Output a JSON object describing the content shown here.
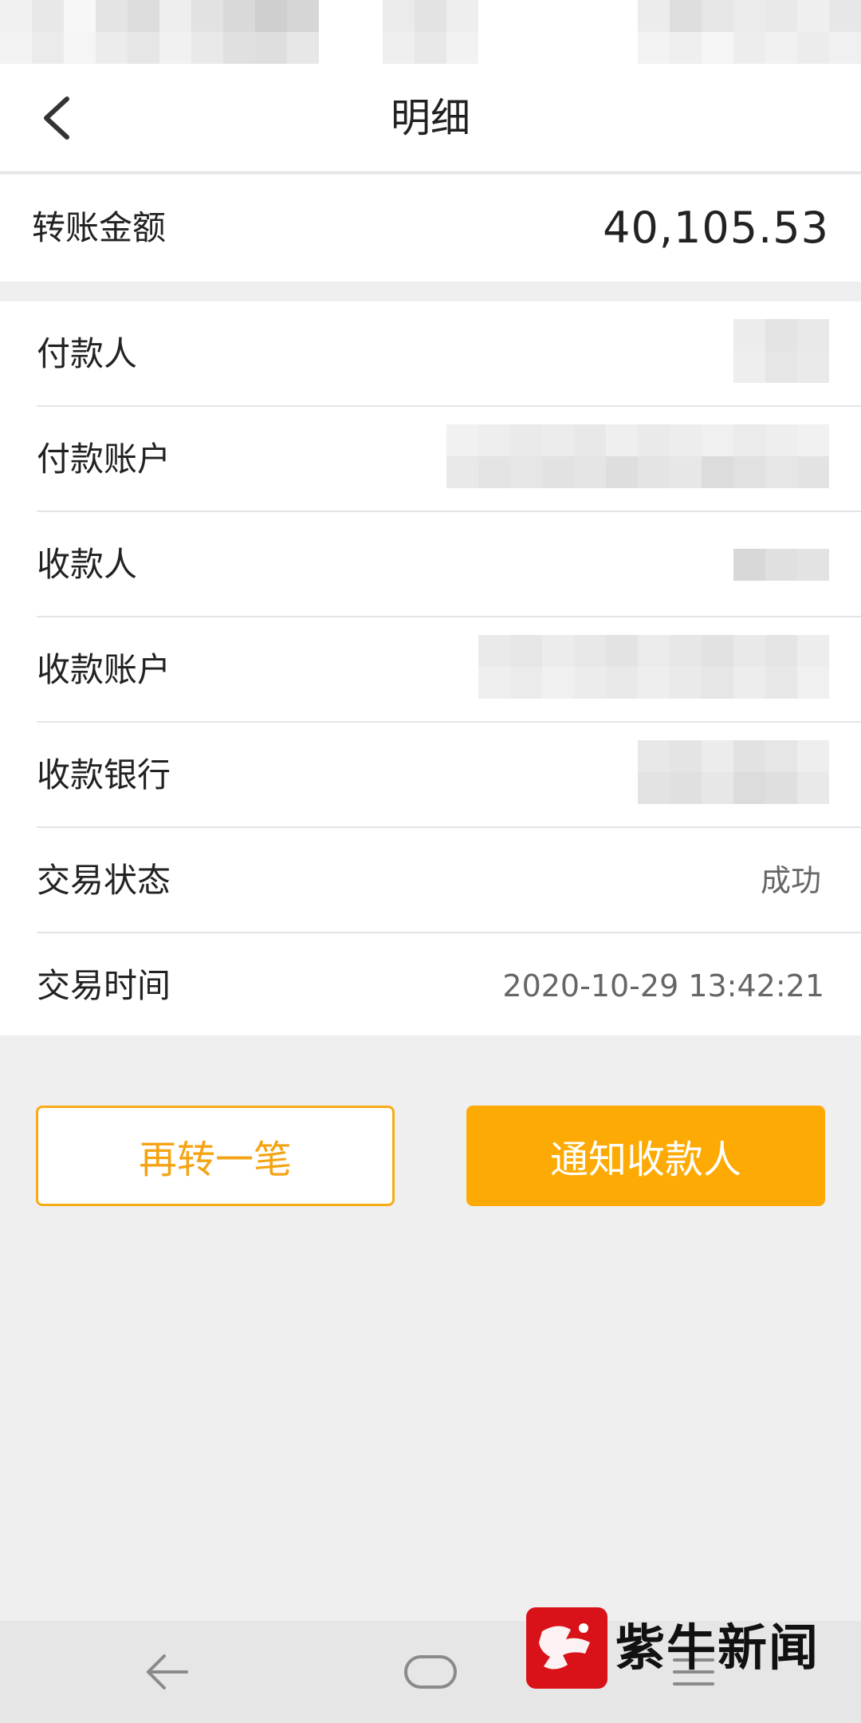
{
  "header": {
    "title": "明细",
    "back_icon": "chevron-left-icon"
  },
  "amount": {
    "label": "转账金额",
    "value": "40,105.53"
  },
  "details": [
    {
      "label": "付款人",
      "value": ""
    },
    {
      "label": "付款账户",
      "value": ""
    },
    {
      "label": "收款人",
      "value": ""
    },
    {
      "label": "收款账户",
      "value": ""
    },
    {
      "label": "收款银行",
      "value": ""
    },
    {
      "label": "交易状态",
      "value": "成功"
    },
    {
      "label": "交易时间",
      "value": "2020-10-29 13:42:21"
    }
  ],
  "actions": {
    "transfer_again": "再转一笔",
    "notify_payee": "通知收款人"
  },
  "system_nav": {
    "back": "back-triangle-icon",
    "home": "home-circle-icon",
    "menu": "menu-lines-icon"
  },
  "watermark": {
    "text": "紫牛新闻"
  },
  "colors": {
    "accent": "#fdab04",
    "accent_text": "#f4a413",
    "background": "#efefef"
  }
}
